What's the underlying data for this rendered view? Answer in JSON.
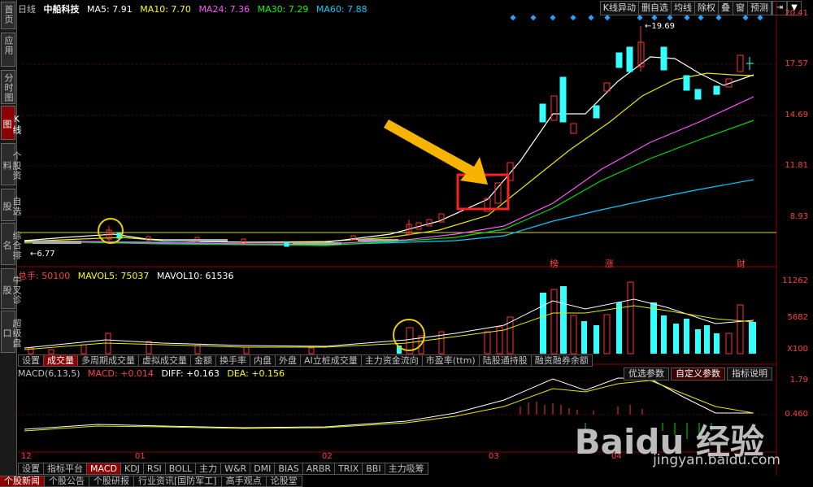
{
  "sidebar": {
    "tabs": [
      {
        "label": "首页",
        "active": false
      },
      {
        "label": "应用",
        "active": false
      },
      {
        "label": "分时图",
        "active": false
      },
      {
        "label": "K线图",
        "active": true
      },
      {
        "label": "个股资料",
        "active": false
      },
      {
        "label": "自选股",
        "active": false
      },
      {
        "label": "综合排名",
        "active": false
      },
      {
        "label": "牛叉诊股",
        "active": false
      },
      {
        "label": "超级盘口",
        "active": false
      }
    ]
  },
  "header": {
    "period": "日线",
    "stock_name": "中船科技",
    "ma5": "MA5: 7.91",
    "ma10": "MA10: 7.70",
    "ma24": "MA24: 7.36",
    "ma30": "MA30: 7.29",
    "ma60": "MA60: 7.88",
    "colors": {
      "ma5": "#ffffff",
      "ma10": "#ffff00",
      "ma24": "#ff55ff",
      "ma30": "#00ff00",
      "ma60": "#00ccff"
    }
  },
  "toolbar": {
    "items": [
      "K线异动",
      "删自选",
      "均线",
      "除权",
      "叠",
      "窗",
      "预测"
    ]
  },
  "price_axis": [
    "20.41",
    "17.57",
    "14.69",
    "11.81",
    "8.93"
  ],
  "price_annotations": {
    "high": "19.69",
    "low": "6.77"
  },
  "event_markers": [
    "榜",
    "涨",
    "财"
  ],
  "volume_header": {
    "total": "总手: 50100",
    "mavol5": "MAVOL5: 75037",
    "mavol10": "MAVOL10: 61536"
  },
  "volume_axis": [
    "11262",
    "5682",
    "X100"
  ],
  "indicator_tabs": [
    {
      "label": "设置",
      "active": false
    },
    {
      "label": "成交量",
      "active": true
    },
    {
      "label": "多周期成交量",
      "active": false
    },
    {
      "label": "虚拟成交量",
      "active": false
    },
    {
      "label": "金额",
      "active": false
    },
    {
      "label": "换手率",
      "active": false
    },
    {
      "label": "内盘",
      "active": false
    },
    {
      "label": "外盘",
      "active": false
    },
    {
      "label": "AI立桩成交量",
      "active": false
    },
    {
      "label": "主力资金流向",
      "active": false
    },
    {
      "label": "市盈率(ttm)",
      "active": false
    },
    {
      "label": "陆股通持股",
      "active": false
    },
    {
      "label": "融资融券余额",
      "active": false
    }
  ],
  "macd_header": {
    "name": "MACD(6,13,5)",
    "macd": "MACD: +0.014",
    "diff": "DIFF: +0.163",
    "dea": "DEA: +0.156"
  },
  "macd_tools": [
    {
      "label": "优选参数",
      "active": false
    },
    {
      "label": "自定义参数",
      "active": true
    },
    {
      "label": "指标说明",
      "active": false
    }
  ],
  "macd_axis": [
    "1.79",
    "0.460"
  ],
  "x_axis": [
    "12",
    "01",
    "02",
    "03",
    "04"
  ],
  "bottom_tabs": [
    {
      "label": "设置",
      "active": false
    },
    {
      "label": "指标平台",
      "active": false
    },
    {
      "label": "MACD",
      "active": true
    },
    {
      "label": "KDJ",
      "active": false
    },
    {
      "label": "RSI",
      "active": false
    },
    {
      "label": "BOLL",
      "active": false
    },
    {
      "label": "主力",
      "active": false
    },
    {
      "label": "W&R",
      "active": false
    },
    {
      "label": "DMI",
      "active": false
    },
    {
      "label": "BIAS",
      "active": false
    },
    {
      "label": "ARBR",
      "active": false
    },
    {
      "label": "TRIX",
      "active": false
    },
    {
      "label": "BBI",
      "active": false
    },
    {
      "label": "主力吸筹",
      "active": false
    }
  ],
  "news_tabs": [
    {
      "label": "个股新闻",
      "active": true
    },
    {
      "label": "个股公告",
      "active": false
    },
    {
      "label": "个股研报",
      "active": false
    },
    {
      "label": "行业资讯[国防军工]",
      "active": false
    },
    {
      "label": "高手观点",
      "active": false
    },
    {
      "label": "论股堂",
      "active": false
    }
  ],
  "watermark": {
    "text": "Baidu 经验",
    "url": "jingyan.baidu.com"
  }
}
